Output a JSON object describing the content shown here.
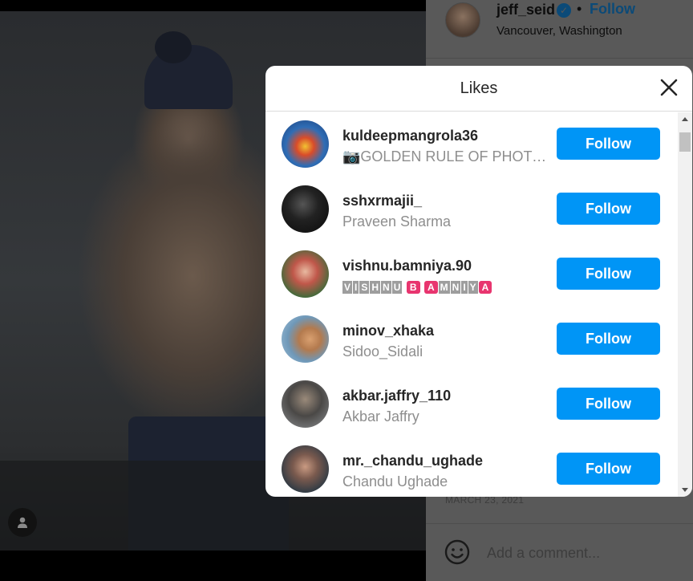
{
  "post": {
    "author": {
      "username": "jeff_seid",
      "verified_mark": "✓",
      "separator": "•",
      "follow_label": "Follow",
      "location": "Vancouver, Washington"
    },
    "date": "MARCH 23, 2021",
    "comment_placeholder": "Add a comment..."
  },
  "likes_modal": {
    "title": "Likes",
    "close_icon": "close-icon",
    "follow_label": "Follow",
    "users": [
      {
        "username": "kuldeepmangrola36",
        "subtitle": "📷GOLDEN RULE OF PHOTOGRAPHY",
        "avatar_color": "#2f6db5"
      },
      {
        "username": "sshxrmajii_",
        "subtitle": "Praveen Sharma",
        "avatar_color": "#161616"
      },
      {
        "username": "vishnu.bamniya.90",
        "subtitle": "VISHNU BAMNIYA",
        "avatar_color": "#b5463c"
      },
      {
        "username": "minov_xhaka",
        "subtitle": "Sidoo_Sidali",
        "avatar_color": "#7ea3c2"
      },
      {
        "username": "akbar.jaffry_110",
        "subtitle": "Akbar Jaffry",
        "avatar_color": "#5b5a58"
      },
      {
        "username": "mr._chandu_ughade",
        "subtitle": "Chandu Ughade",
        "avatar_color": "#2e3a44"
      }
    ],
    "fancy_name": {
      "part1": [
        "V",
        "I",
        "S",
        "H",
        "N",
        "U"
      ],
      "part2": [
        "B"
      ],
      "part3": [
        "A"
      ],
      "part4": [
        "M",
        "N",
        "I",
        "Y"
      ],
      "part5": [
        "A"
      ]
    }
  },
  "colors": {
    "accent": "#0095f6",
    "overlay": "#595959",
    "modal_bg": "#ffffff",
    "muted_text": "#8e8e8e"
  }
}
